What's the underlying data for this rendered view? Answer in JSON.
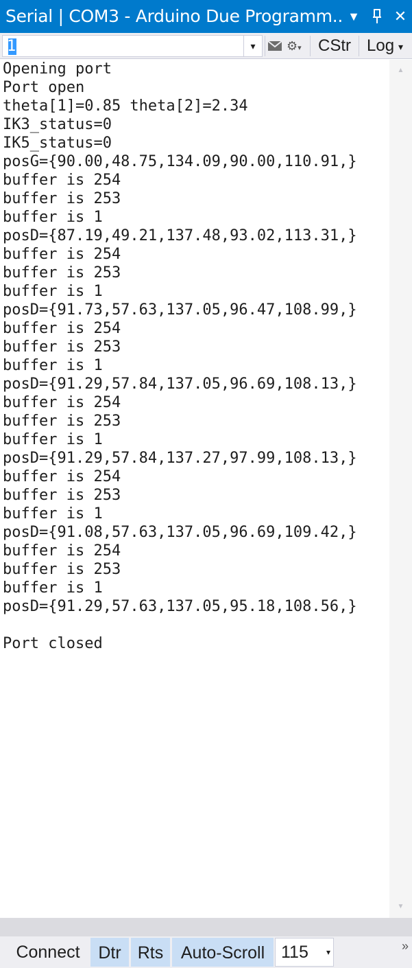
{
  "window": {
    "title": "Serial | COM3   - Arduino Due Programm...",
    "dropdown_glyph": "▼",
    "pin_glyph": "🖈",
    "close_glyph": "✕"
  },
  "toolbar": {
    "input_value": "1",
    "input_dropdown_glyph": "▾",
    "cstr_label": "CStr",
    "log_label": "Log",
    "log_chevron": "▾"
  },
  "output": {
    "lines": [
      "Opening port",
      "Port open",
      "theta[1]=0.85 theta[2]=2.34",
      "IK3_status=0",
      "IK5_status=0",
      "posG={90.00,48.75,134.09,90.00,110.91,}",
      "buffer is 254",
      "buffer is 253",
      "buffer is 1",
      "posD={87.19,49.21,137.48,93.02,113.31,}",
      "buffer is 254",
      "buffer is 253",
      "buffer is 1",
      "posD={91.73,57.63,137.05,96.47,108.99,}",
      "buffer is 254",
      "buffer is 253",
      "buffer is 1",
      "posD={91.29,57.84,137.05,96.69,108.13,}",
      "buffer is 254",
      "buffer is 253",
      "buffer is 1",
      "posD={91.29,57.84,137.27,97.99,108.13,}",
      "buffer is 254",
      "buffer is 253",
      "buffer is 1",
      "posD={91.08,57.63,137.05,96.69,109.42,}",
      "buffer is 254",
      "buffer is 253",
      "buffer is 1",
      "posD={91.29,57.63,137.05,95.18,108.56,}",
      "",
      "Port closed"
    ]
  },
  "scrollbar": {
    "up_glyph": "▲",
    "down_glyph": "▼"
  },
  "bottombar": {
    "connect_label": "Connect",
    "dtr_label": "Dtr",
    "rts_label": "Rts",
    "autoscroll_label": "Auto-Scroll",
    "baud_value": "115",
    "baud_dropdown_glyph": "▾",
    "overflow_glyph": "»"
  },
  "colors": {
    "titlebar": "#007acc",
    "toggle_checked": "#c9def5",
    "selection": "#3399ff"
  }
}
